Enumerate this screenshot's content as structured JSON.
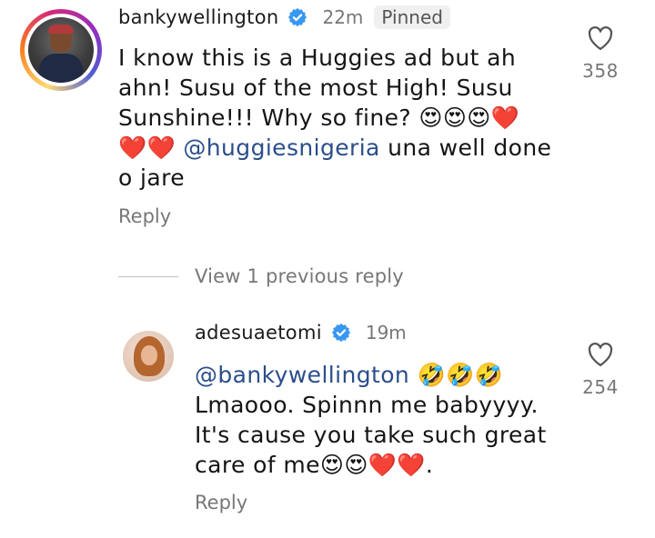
{
  "comments": {
    "main": {
      "username": "bankywellington",
      "time": "22m",
      "pinned_label": "Pinned",
      "text_line1": "I know this is a Huggies ad but ah",
      "text_line2": "ahn! Susu of the most High! Susu",
      "text_line3_prefix": "Sunshine!!! Why so fine? ",
      "text_line3_emoji": "😍😍😍❤️",
      "text_line4_emoji": "❤️❤️ ",
      "mention": "@huggiesnigeria",
      "text_line4_suffix": " una well done",
      "text_line5": "o jare",
      "reply_label": "Reply",
      "likes": "358"
    },
    "view_previous_label": "View 1 previous reply",
    "reply": {
      "username": "adesuaetomi",
      "time": "19m",
      "mention": "@bankywellington",
      "mention_emoji": " 🤣🤣🤣",
      "text_line2": "Lmaooo. Spinnn me babyyyy.",
      "text_line3": "It's cause you take such great",
      "text_line4_prefix": "care of me",
      "text_line4_emoji": "😍😍❤️❤️",
      "text_line4_suffix": ".",
      "reply_label": "Reply",
      "likes": "254"
    }
  },
  "icons": {
    "verified": "verified-badge-icon",
    "like": "heart-outline-icon"
  },
  "colors": {
    "verified": "#3897f0",
    "mention": "#2b4e8c",
    "secondary_text": "#777777"
  }
}
